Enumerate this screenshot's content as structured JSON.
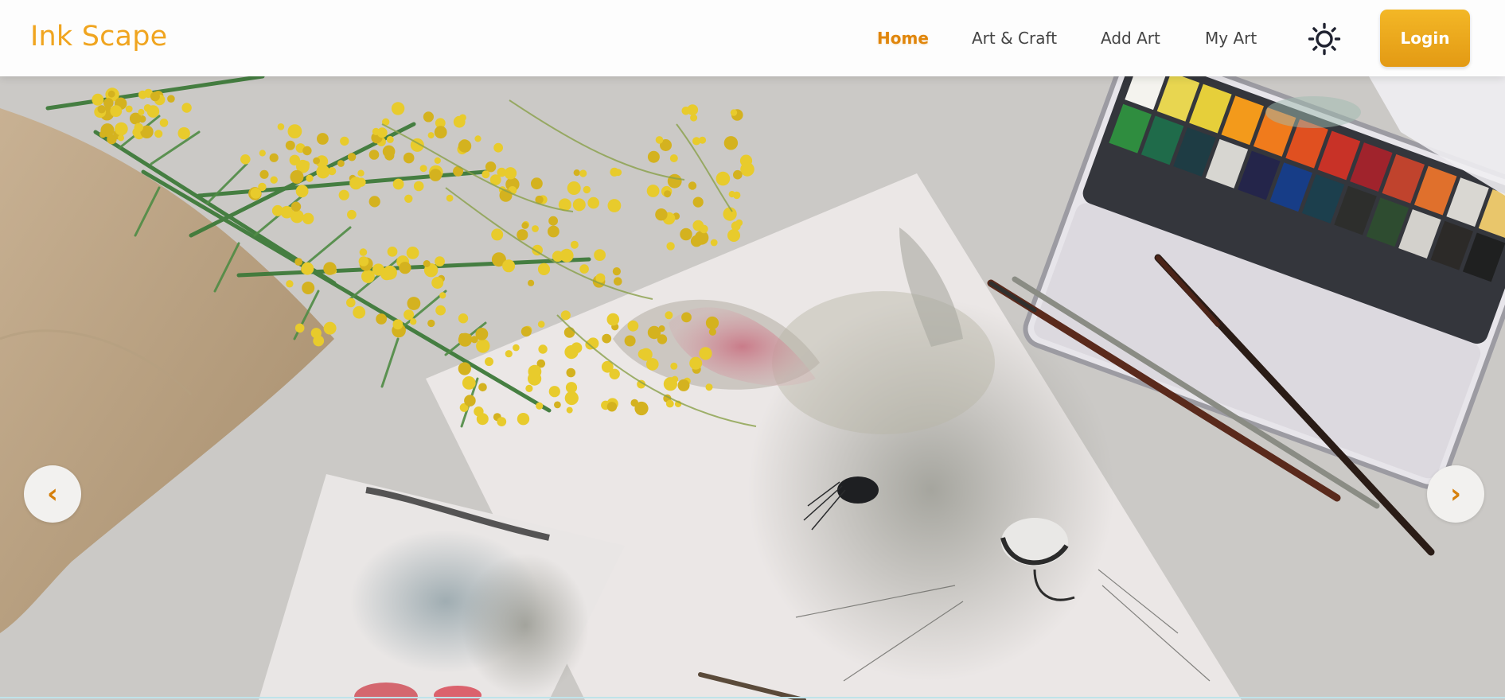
{
  "brand": {
    "name": "Ink Scape",
    "color": "#f0a520"
  },
  "nav": {
    "links": [
      {
        "label": "Home",
        "active": true
      },
      {
        "label": "Art & Craft",
        "active": false
      },
      {
        "label": "Add Art",
        "active": false
      },
      {
        "label": "My Art",
        "active": false
      }
    ],
    "theme_toggle_icon": "sun-icon",
    "login_label": "Login",
    "accent_color": "#e0860c"
  },
  "carousel": {
    "prev_label": "‹",
    "next_label": "›",
    "slide_image": "watercolor-bunny-painting-with-mimosa-flowers-and-paint-palette"
  }
}
